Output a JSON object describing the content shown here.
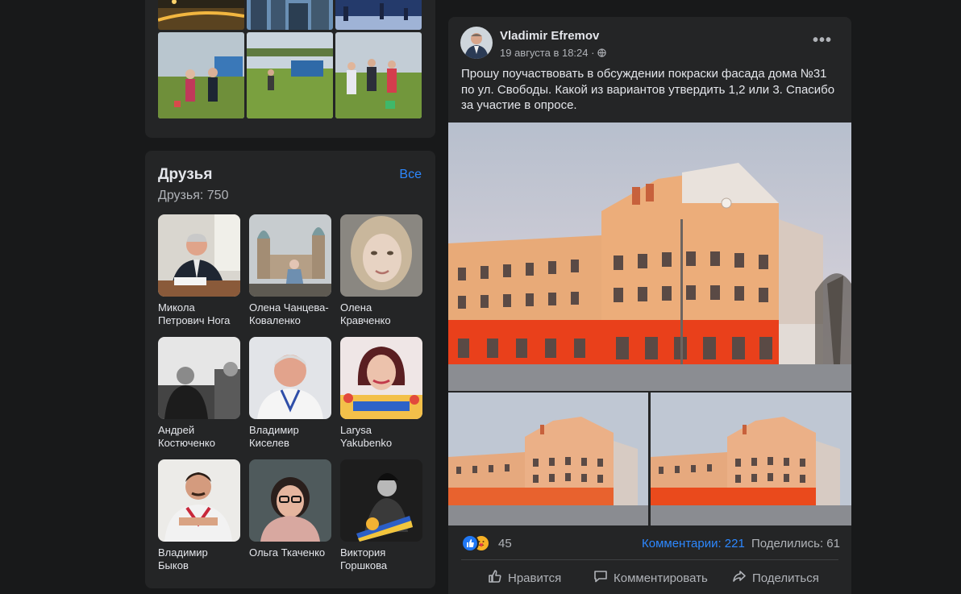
{
  "friends": {
    "title": "Друзья",
    "see_all": "Все",
    "count_label": "Друзья: 750",
    "items": [
      {
        "name": "Микола Петрович Нога"
      },
      {
        "name": "Олена Чанцева-Коваленко"
      },
      {
        "name": "Олена Кравченко"
      },
      {
        "name": "Андрей Костюченко"
      },
      {
        "name": "Владимир Киселев"
      },
      {
        "name": "Larysa Yakubenko"
      },
      {
        "name": "Владимир Быков"
      },
      {
        "name": "Ольга Ткаченко"
      },
      {
        "name": "Виктория Горшкова"
      }
    ]
  },
  "post": {
    "author": "Vladimir Efremov",
    "date": "19 августа в 18:24",
    "privacy_icon": "globe-icon",
    "more_icon": "more-dots-icon",
    "text": "Прошу поучаствовать в обсуждении покраски фасада дома №31 по ул. Свободы. Какой из вариантов утвердить 1,2 или 3. Спасибо за участие в опросе.",
    "reactions": {
      "icons": [
        "like-icon",
        "care-icon"
      ],
      "count": "45"
    },
    "comments": "Комментарии: 221",
    "shares": "Поделились: 61",
    "actions": {
      "like": "Нравится",
      "comment": "Комментировать",
      "share": "Поделиться"
    }
  },
  "colors": {
    "background": "#18191a",
    "card": "#242526",
    "link": "#2d88ff",
    "muted": "#b0b3b8",
    "text": "#e4e6eb"
  }
}
